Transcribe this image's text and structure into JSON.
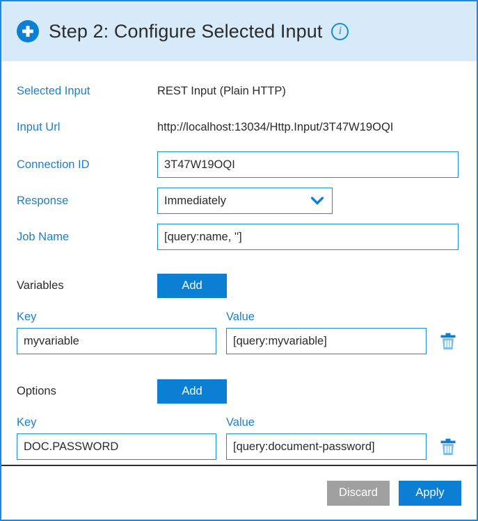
{
  "header": {
    "title": "Step 2: Configure Selected Input",
    "plus_icon": "plus-circle-icon",
    "info_icon": "info-circle-icon",
    "accent_color": "#0b7fd4",
    "background_color": "#d6eaf9"
  },
  "form": {
    "selected_input": {
      "label": "Selected Input",
      "value": "REST Input (Plain HTTP)"
    },
    "input_url": {
      "label": "Input Url",
      "value": "http://localhost:13034/Http.Input/3T47W19OQI"
    },
    "connection_id": {
      "label": "Connection ID",
      "value": "3T47W19OQI",
      "placeholder": ""
    },
    "response": {
      "label": "Response",
      "value": "Immediately",
      "options": [
        "Immediately"
      ],
      "chevron_icon": "chevron-down-icon"
    },
    "job_name": {
      "label": "Job Name",
      "value": "[query:name, '']",
      "placeholder": ""
    }
  },
  "variables": {
    "title": "Variables",
    "add_label": "Add",
    "key_header": "Key",
    "value_header": "Value",
    "rows": [
      {
        "key": "myvariable",
        "value": "[query:myvariable]",
        "delete_icon": "trash-icon"
      }
    ]
  },
  "options": {
    "title": "Options",
    "add_label": "Add",
    "key_header": "Key",
    "value_header": "Value",
    "rows": [
      {
        "key": "DOC.PASSWORD",
        "value": "[query:document-password]",
        "delete_icon": "trash-icon"
      }
    ]
  },
  "footer": {
    "discard_label": "Discard",
    "apply_label": "Apply",
    "discard_color": "#a0a0a0",
    "apply_color": "#0b7fd4"
  }
}
